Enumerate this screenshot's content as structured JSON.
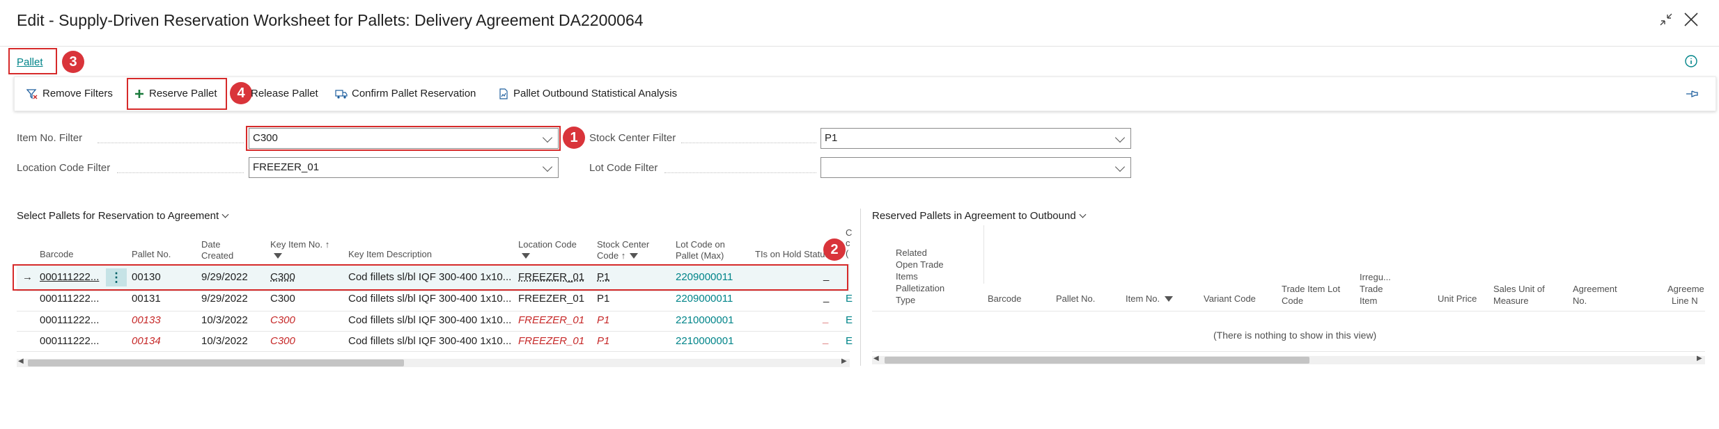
{
  "window": {
    "title": "Edit - Supply-Driven Reservation Worksheet for Pallets: Delivery Agreement DA2200064"
  },
  "tab": {
    "label": "Pallet"
  },
  "badges": {
    "b1": "1",
    "b2": "2",
    "b3": "3",
    "b4": "4"
  },
  "actions": {
    "remove_filters": "Remove Filters",
    "reserve_pallet": "Reserve Pallet",
    "release_pallet": "Release Pallet",
    "confirm_reservation": "Confirm Pallet Reservation",
    "outbound_analysis": "Pallet Outbound Statistical Analysis"
  },
  "filters": {
    "item_no": {
      "label": "Item No. Filter",
      "value": "C300"
    },
    "location_code": {
      "label": "Location Code Filter",
      "value": "FREEZER_01"
    },
    "stock_center": {
      "label": "Stock Center Filter",
      "value": "P1"
    },
    "lot_code": {
      "label": "Lot Code Filter",
      "value": ""
    }
  },
  "left_grid": {
    "title": "Select Pallets for Reservation to Agreement",
    "headers": {
      "barcode": "Barcode",
      "pallet_no": "Pallet No.",
      "date_created_1": "Date",
      "date_created_2": "Created",
      "key_item_no": "Key Item No. ↑",
      "key_item_desc": "Key Item Description",
      "location_code": "Location Code",
      "stock_center_1": "Stock Center",
      "stock_center_2": "Code ↑",
      "lot_code_1": "Lot Code on",
      "lot_code_2": "Pallet (Max)",
      "tis_on_hold": "TIs on Hold Status",
      "trunc_1": "C",
      "trunc_2": "c",
      "trunc_3": "("
    },
    "rows": [
      {
        "barcode": "000111222...",
        "pallet_no": "00130",
        "date": "9/29/2022",
        "item": "C300",
        "desc": "Cod fillets sl/bl IQF 300-400 1x10...",
        "location": "FREEZER_01",
        "stock": "P1",
        "lot": "2209000011",
        "status": "_",
        "extra": ""
      },
      {
        "barcode": "000111222...",
        "pallet_no": "00131",
        "date": "9/29/2022",
        "item": "C300",
        "desc": "Cod fillets sl/bl IQF 300-400 1x10...",
        "location": "FREEZER_01",
        "stock": "P1",
        "lot": "2209000011",
        "status": "_",
        "extra": "E"
      },
      {
        "barcode": "000111222...",
        "pallet_no": "00133",
        "date": "10/3/2022",
        "item": "C300",
        "desc": "Cod fillets sl/bl IQF 300-400 1x10...",
        "location": "FREEZER_01",
        "stock": "P1",
        "lot": "2210000001",
        "status": "_",
        "extra": "E"
      },
      {
        "barcode": "000111222...",
        "pallet_no": "00134",
        "date": "10/3/2022",
        "item": "C300",
        "desc": "Cod fillets sl/bl IQF 300-400 1x10...",
        "location": "FREEZER_01",
        "stock": "P1",
        "lot": "2210000001",
        "status": "_",
        "extra": "E"
      }
    ]
  },
  "right_grid": {
    "title": "Reserved Pallets in Agreement to Outbound",
    "headers": {
      "related_1": "Related",
      "related_2": "Open Trade",
      "related_3": "Items",
      "related_4": "Palletization",
      "related_5": "Type",
      "barcode": "Barcode",
      "pallet_no": "Pallet No.",
      "item_no": "Item No.",
      "variant": "Variant Code",
      "lot_1": "Trade Item Lot",
      "lot_2": "Code",
      "irreg_1": "Irregu...",
      "irreg_2": "Trade",
      "irreg_3": "Item",
      "unit_price": "Unit Price",
      "uom_1": "Sales Unit of",
      "uom_2": "Measure",
      "agr_1": "Agreement",
      "agr_2": "No.",
      "agl_1": "Agreeme",
      "agl_2": "Line N"
    },
    "empty": "(There is nothing to show in this view)"
  }
}
